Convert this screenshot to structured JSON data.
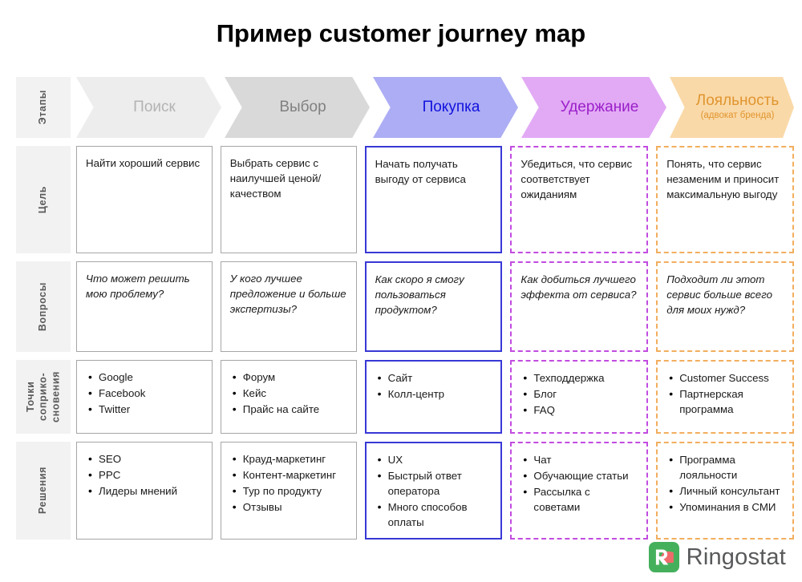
{
  "title": "Пример customer journey map",
  "stages_label": "Этапы",
  "stages": [
    {
      "name": "Поиск",
      "sub": "",
      "fill": "#ededed",
      "text_color": "#b3b3b3"
    },
    {
      "name": "Выбор",
      "sub": "",
      "fill": "#d9d9d9",
      "text_color": "#808080"
    },
    {
      "name": "Покупка",
      "sub": "",
      "fill": "#adadf5",
      "text_color": "#1111dd"
    },
    {
      "name": "Удержание",
      "sub": "",
      "fill": "#e2aaf5",
      "text_color": "#9b20c9"
    },
    {
      "name": "Лояльность",
      "sub": "(адвокат бренда)",
      "fill": "#fad9a8",
      "text_color": "#e0952f"
    }
  ],
  "rows": [
    {
      "label": "Цель",
      "kind": "text",
      "cells": [
        {
          "style": "b-solid-gray",
          "text": "Найти хороший сервис"
        },
        {
          "style": "b-solid-gray",
          "text": "Выбрать сервис с наилучшей ценой/качеством"
        },
        {
          "style": "b-solid-blue",
          "text": "Начать получать выгоду от сервиса"
        },
        {
          "style": "b-dash-purple",
          "text": "Убедиться, что сервис соответствует ожиданиям"
        },
        {
          "style": "b-dash-orange",
          "text": "Понять, что сервис незаменим и приносит максимальную выгоду"
        }
      ]
    },
    {
      "label": "Вопросы",
      "kind": "text-italic",
      "cells": [
        {
          "style": "b-solid-gray",
          "text": "Что может решить мою проблему?"
        },
        {
          "style": "b-solid-gray",
          "text": "У кого лучшее предложение и больше экспертизы?"
        },
        {
          "style": "b-solid-blue",
          "text": "Как скоро я смогу пользоваться продуктом?"
        },
        {
          "style": "b-dash-purple",
          "text": "Как добиться лучшего эффекта от сервиса?"
        },
        {
          "style": "b-dash-orange",
          "text": "Подходит ли этот сервис больше всего для моих нужд?"
        }
      ]
    },
    {
      "label": "Точки\nсоприко-\nсновения",
      "kind": "list",
      "cells": [
        {
          "style": "b-solid-gray",
          "items": [
            "Google",
            "Facebook",
            "Twitter"
          ]
        },
        {
          "style": "b-solid-gray",
          "items": [
            "Форум",
            "Кейс",
            "Прайс на сайте"
          ]
        },
        {
          "style": "b-solid-blue",
          "items": [
            "Сайт",
            "Колл-центр"
          ]
        },
        {
          "style": "b-dash-purple",
          "items": [
            "Техподдержка",
            "Блог",
            "FAQ"
          ]
        },
        {
          "style": "b-dash-orange",
          "items": [
            "Customer Success",
            "Партнерская программа"
          ]
        }
      ]
    },
    {
      "label": "Решения",
      "kind": "list",
      "cells": [
        {
          "style": "b-solid-gray",
          "items": [
            "SEO",
            "PPC",
            "Лидеры мнений"
          ]
        },
        {
          "style": "b-solid-gray",
          "items": [
            "Крауд-маркетинг",
            "Контент-маркетинг",
            "Тур по продукту",
            "Отзывы"
          ]
        },
        {
          "style": "b-solid-blue",
          "items": [
            "UX",
            "Быстрый ответ оператора",
            "Много способов оплаты"
          ]
        },
        {
          "style": "b-dash-purple",
          "items": [
            "Чат",
            "Обучающие статьи",
            "Рассылка с советами"
          ]
        },
        {
          "style": "b-dash-orange",
          "items": [
            "Программа лояльности",
            "Личный консультант",
            "Упоминания в СМИ"
          ]
        }
      ]
    }
  ],
  "logo": {
    "name": "Ringostat",
    "mark_color": "#45b05c",
    "accent_color": "#ef6b6b",
    "text_color": "#58595b"
  }
}
